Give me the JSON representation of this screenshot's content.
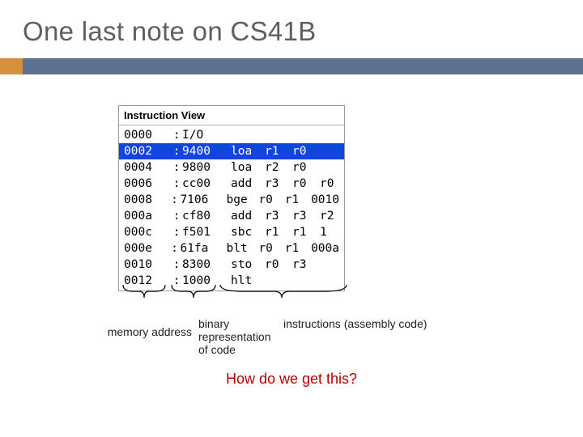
{
  "title": "One last note on CS41B",
  "panel_header": "Instruction View",
  "rows": [
    {
      "addr": "0000",
      "sep": ":",
      "hex": "I/O",
      "mn": "",
      "a1": "",
      "a2": "",
      "a3": "",
      "selected": false
    },
    {
      "addr": "0002",
      "sep": ":",
      "hex": "9400",
      "mn": "loa",
      "a1": "r1",
      "a2": "r0",
      "a3": "",
      "selected": true
    },
    {
      "addr": "0004",
      "sep": ":",
      "hex": "9800",
      "mn": "loa",
      "a1": "r2",
      "a2": "r0",
      "a3": "",
      "selected": false
    },
    {
      "addr": "0006",
      "sep": ":",
      "hex": "cc00",
      "mn": "add",
      "a1": "r3",
      "a2": "r0",
      "a3": "r0",
      "selected": false
    },
    {
      "addr": "0008",
      "sep": ":",
      "hex": "7106",
      "mn": "bge",
      "a1": "r0",
      "a2": "r1",
      "a3": "0010",
      "selected": false
    },
    {
      "addr": "000a",
      "sep": ":",
      "hex": "cf80",
      "mn": "add",
      "a1": "r3",
      "a2": "r3",
      "a3": "r2",
      "selected": false
    },
    {
      "addr": "000c",
      "sep": ":",
      "hex": "f501",
      "mn": "sbc",
      "a1": "r1",
      "a2": "r1",
      "a3": "1",
      "selected": false
    },
    {
      "addr": "000e",
      "sep": ":",
      "hex": "61fa",
      "mn": "blt",
      "a1": "r0",
      "a2": "r1",
      "a3": "000a",
      "selected": false
    },
    {
      "addr": "0010",
      "sep": ":",
      "hex": "8300",
      "mn": "sto",
      "a1": "r0",
      "a2": "r3",
      "a3": "",
      "selected": false
    },
    {
      "addr": "0012",
      "sep": ":",
      "hex": "1000",
      "mn": "hlt",
      "a1": "",
      "a2": "",
      "a3": "",
      "selected": false
    }
  ],
  "labels": {
    "memory": "memory address",
    "binary": "binary representation of code",
    "instructions": "instructions (assembly code)"
  },
  "question": "How do we get this?"
}
